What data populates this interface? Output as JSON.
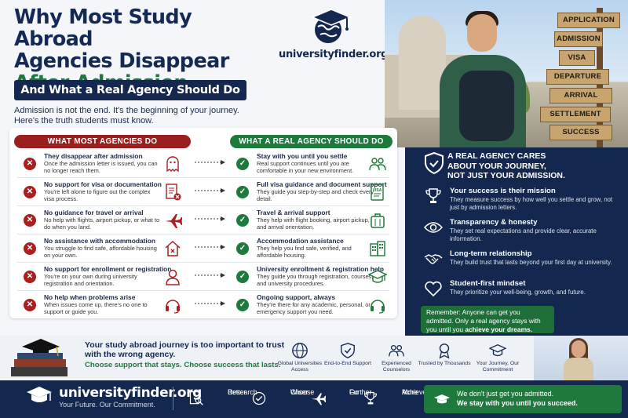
{
  "header": {
    "title_line1": "Why Most Study Abroad",
    "title_line2": "Agencies Disappear",
    "title_line3": "After Admission —",
    "banner": "And What a Real Agency Should Do",
    "intro": "Admission is not the end. It's the beginning of your journey. Here's the truth students must know."
  },
  "logo": {
    "text": "universityfinder.org",
    "icon": "graduation-cap-globe-icon"
  },
  "signs": [
    "APPLICATION",
    "ADMISSION",
    "VISA",
    "DEPARTURE",
    "ARRIVAL",
    "SETTLEMENT",
    "SUCCESS"
  ],
  "compare": {
    "bad_heading": "WHAT MOST AGENCIES DO",
    "good_heading": "WHAT A REAL AGENCY SHOULD DO",
    "bad": [
      {
        "title": "They disappear after admission",
        "desc": "Once the admission letter is issued, you can no longer reach them.",
        "icon": "ghost-icon"
      },
      {
        "title": "No support for visa or documentation",
        "desc": "You're left alone to figure out the complex visa process.",
        "icon": "document-x-icon"
      },
      {
        "title": "No guidance for travel or arrival",
        "desc": "No help with flights, airport pickup, or what to do when you land.",
        "icon": "airplane-icon"
      },
      {
        "title": "No assistance with accommodation",
        "desc": "You struggle to find safe, affordable housing on your own.",
        "icon": "house-x-icon"
      },
      {
        "title": "No support for enrollment or registration",
        "desc": "You're on your own during university registration and orientation.",
        "icon": "person-icon"
      },
      {
        "title": "No help when problems arise",
        "desc": "When issues come up, there's no one to support or guide you.",
        "icon": "headset-icon"
      }
    ],
    "good": [
      {
        "title": "Stay with you until you settle",
        "desc": "Real support continues until you are comfortable in your new environment.",
        "icon": "people-icon"
      },
      {
        "title": "Full visa guidance and document support",
        "desc": "They guide you step-by-step and check every detail.",
        "icon": "visa-document-icon"
      },
      {
        "title": "Travel & arrival support",
        "desc": "They help with flight booking, airport pickup, and arrival orientation.",
        "icon": "suitcase-icon"
      },
      {
        "title": "Accommodation assistance",
        "desc": "They help you find safe, verified, and affordable housing.",
        "icon": "building-icon"
      },
      {
        "title": "University enrollment & registration help",
        "desc": "They guide you through registration, courses, and university procedures.",
        "icon": "graduation-cap-icon"
      },
      {
        "title": "Ongoing support, always",
        "desc": "They're there for any academic, personal, or emergency support you need.",
        "icon": "headset-icon"
      }
    ]
  },
  "right_panel": {
    "heading_line1": "A REAL AGENCY CARES",
    "heading_line2": "ABOUT YOUR JOURNEY,",
    "heading_line3": "NOT JUST YOUR ADMISSION.",
    "items": [
      {
        "title": "Your success is their mission",
        "desc": "They measure success by how well you settle and grow, not just by admission letters.",
        "icon": "trophy-icon"
      },
      {
        "title": "Transparency & honesty",
        "desc": "They set real expectations and provide clear, accurate information.",
        "icon": "eye-icon"
      },
      {
        "title": "Long-term relationship",
        "desc": "They build trust that lasts beyond your first day at university.",
        "icon": "handshake-icon"
      },
      {
        "title": "Student-first mindset",
        "desc": "They prioritize your well-being, growth, and future.",
        "icon": "heart-icon"
      }
    ],
    "remember_prefix": "Remember: Anyone can get you admitted. Only a real agency stays with you until you ",
    "remember_bold": "achieve your dreams."
  },
  "strip": {
    "line1": "Your study abroad journey is too important to trust with the wrong agency.",
    "line2": "Choose support that stays. Choose success that lasts.",
    "features": [
      {
        "label": "Global Universities Access",
        "icon": "globe-icon"
      },
      {
        "label": "End-to-End Support",
        "icon": "shield-check-icon"
      },
      {
        "label": "Experienced Counselors",
        "icon": "people-icon"
      },
      {
        "label": "Trusted by Thousands",
        "icon": "award-icon"
      },
      {
        "label": "Your Journey, Our Commitment",
        "icon": "graduation-cap-icon"
      }
    ]
  },
  "footer": {
    "name": "universityfinder.org",
    "tagline": "Your Future. Our Commitment.",
    "items": [
      {
        "line1": "Research",
        "line2": "Better",
        "icon": "search-document-icon"
      },
      {
        "line1": "Choose",
        "line2": "Wiser",
        "icon": "check-circle-icon"
      },
      {
        "line1": "Go",
        "line2": "Further",
        "icon": "airplane-icon"
      },
      {
        "line1": "Achieve",
        "line2": "More",
        "icon": "trophy-icon"
      }
    ],
    "cta_line1": "We don't just get you admitted.",
    "cta_line2": "We stay with you until you succeed."
  },
  "colors": {
    "navy": "#14284f",
    "green": "#1e7a3c",
    "red": "#9b1f1f"
  }
}
